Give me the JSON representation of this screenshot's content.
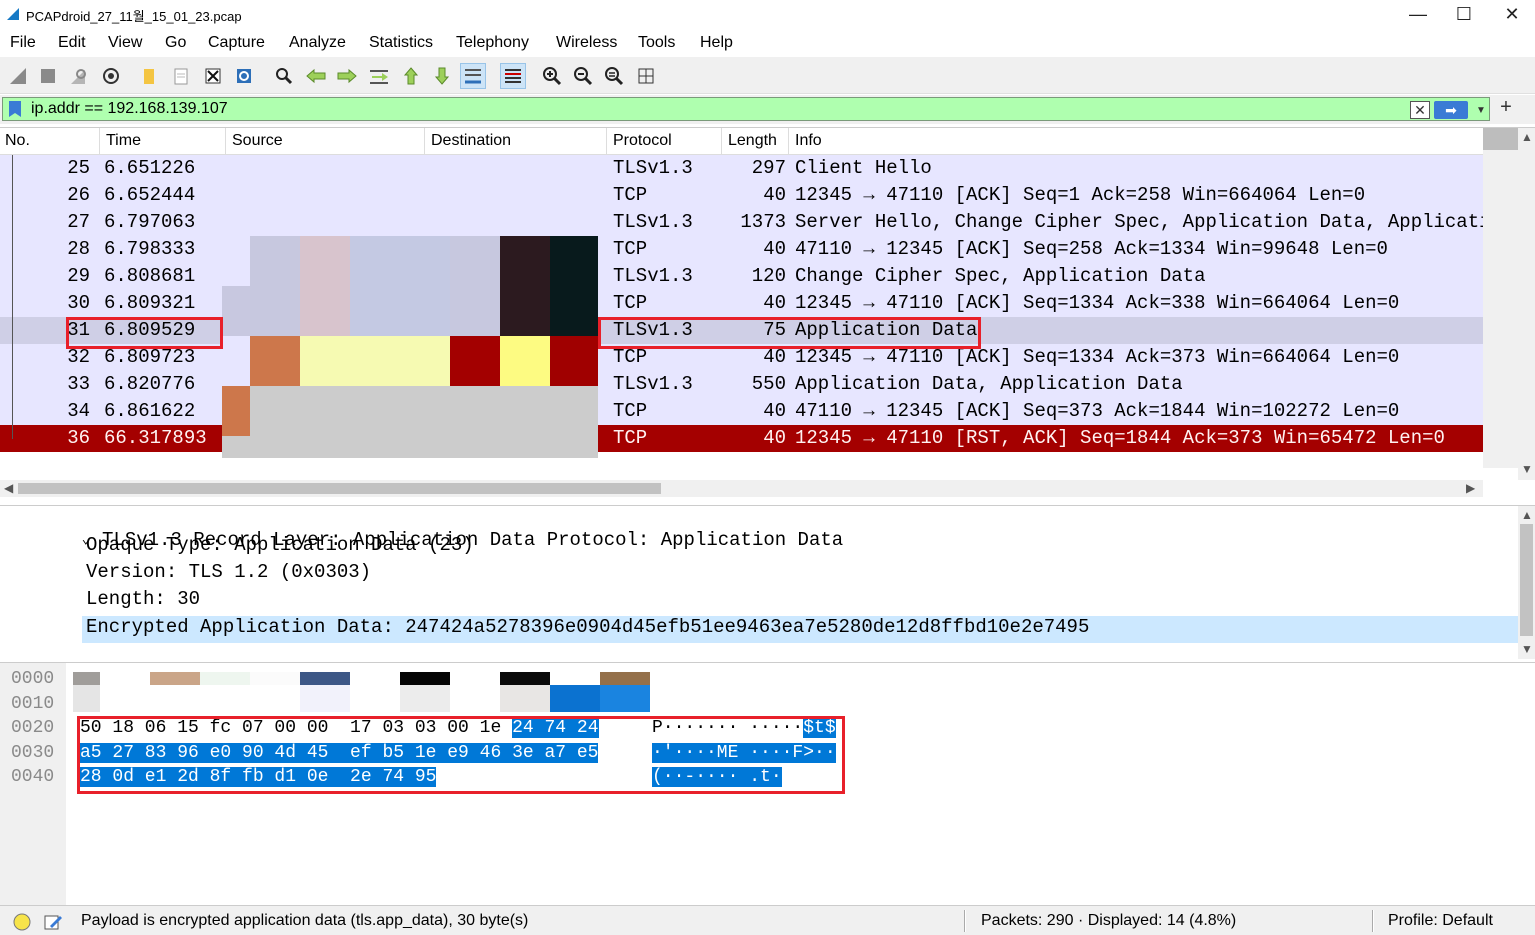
{
  "window": {
    "title": "PCAPdroid_27_11월_15_01_23.pcap",
    "minimize": "—",
    "maximize": "☐",
    "close": "✕"
  },
  "menu": [
    "File",
    "Edit",
    "View",
    "Go",
    "Capture",
    "Analyze",
    "Statistics",
    "Telephony",
    "Wireless",
    "Tools",
    "Help"
  ],
  "filter": {
    "value": "ip.addr == 192.168.139.107",
    "clear": "✕",
    "apply": "➡",
    "dropdown": "▼",
    "add": "+"
  },
  "columns": [
    "No.",
    "Time",
    "Source",
    "Destination",
    "Protocol",
    "Length",
    "Info"
  ],
  "packets": [
    {
      "no": "25",
      "time": "6.651226",
      "proto": "TLSv1.3",
      "len": "297",
      "info": "Client Hello",
      "style": "norm"
    },
    {
      "no": "26",
      "time": "6.652444",
      "proto": "TCP",
      "len": "40",
      "info": "12345 → 47110 [ACK] Seq=1 Ack=258 Win=664064 Len=0",
      "style": "norm"
    },
    {
      "no": "27",
      "time": "6.797063",
      "proto": "TLSv1.3",
      "len": "1373",
      "info": "Server Hello, Change Cipher Spec, Application Data, Applicati",
      "style": "norm"
    },
    {
      "no": "28",
      "time": "6.798333",
      "proto": "TCP",
      "len": "40",
      "info": "47110 → 12345 [ACK] Seq=258 Ack=1334 Win=99648 Len=0",
      "style": "norm"
    },
    {
      "no": "29",
      "time": "6.808681",
      "proto": "TLSv1.3",
      "len": "120",
      "info": "Change Cipher Spec, Application Data",
      "style": "norm"
    },
    {
      "no": "30",
      "time": "6.809321",
      "proto": "TCP",
      "len": "40",
      "info": "12345 → 47110 [ACK] Seq=1334 Ack=338 Win=664064 Len=0",
      "style": "norm"
    },
    {
      "no": "31",
      "time": "6.809529",
      "proto": "TLSv1.3",
      "len": "75",
      "info": "Application Data",
      "style": "sel"
    },
    {
      "no": "32",
      "time": "6.809723",
      "proto": "TCP",
      "len": "40",
      "info": "12345 → 47110 [ACK] Seq=1334 Ack=373 Win=664064 Len=0",
      "style": "norm"
    },
    {
      "no": "33",
      "time": "6.820776",
      "proto": "TLSv1.3",
      "len": "550",
      "info": "Application Data, Application Data",
      "style": "norm"
    },
    {
      "no": "34",
      "time": "6.861622",
      "proto": "TCP",
      "len": "40",
      "info": "47110 → 12345 [ACK] Seq=373 Ack=1844 Win=102272 Len=0",
      "style": "norm"
    },
    {
      "no": "36",
      "time": "66.317893",
      "proto": "TCP",
      "len": "40",
      "info": "12345 → 47110 [RST, ACK] Seq=1844 Ack=373 Win=65472 Len=0",
      "style": "rst"
    }
  ],
  "details": [
    {
      "text": "TLSv1.3 Record Layer: Application Data Protocol: Application Data",
      "indent": 0,
      "expander": "⌄"
    },
    {
      "text": "Opaque Type: Application Data (23)",
      "indent": 1
    },
    {
      "text": "Version: TLS 1.2 (0x0303)",
      "indent": 1
    },
    {
      "text": "Length: 30",
      "indent": 1
    },
    {
      "text": "Encrypted Application Data: 247424a5278396e0904d45efb51ee9463ea7e5280de12d8ffbd10e2e7495",
      "indent": 1,
      "highlight": true
    }
  ],
  "hex": {
    "offsets": [
      "0000",
      "0010",
      "0020",
      "0030",
      "0040"
    ],
    "row2_plain": "50 18 06 15 fc 07 00 00  17 03 03 00 1e ",
    "row2_sel": "24 74 24",
    "row2_ascii_plain": "P······· ·····",
    "row2_ascii_sel": "$t$",
    "row3_hex": "a5 27 83 96 e0 90 4d 45  ef b5 1e e9 46 3e a7 e5",
    "row3_ascii": "·'····ME ····F>··",
    "row4_hex": "28 0d e1 2d 8f fb d1 0e  2e 74 95",
    "row4_ascii": "(··-···· .t·"
  },
  "status": {
    "message": "Payload is encrypted application data (tls.app_data), 30 byte(s)",
    "packets": "Packets: 290 · Displayed: 14 (4.8%)",
    "profile": "Profile: Default"
  },
  "colors": {
    "row_normal": "#e7e6ff",
    "row_selected": "#cfcfe6",
    "row_rst": "#a40000",
    "filter_ok": "#afffaf",
    "highlight_box": "#e8202a",
    "hex_selection": "#0078d7"
  }
}
